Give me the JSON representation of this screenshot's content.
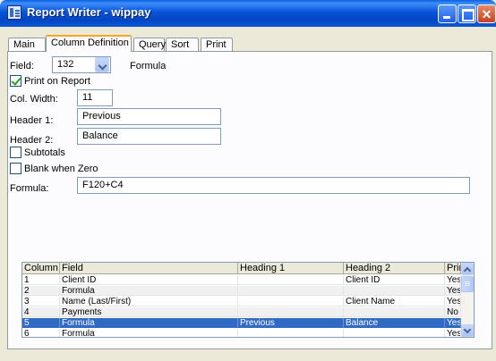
{
  "window": {
    "title": "Report Writer - wippay",
    "colors": {
      "titlebar": "#0753d8",
      "selection": "#316ac5",
      "tab_highlight": "#f5a623"
    }
  },
  "tabs": [
    {
      "label": "Main",
      "active": false
    },
    {
      "label": "Column Definition",
      "active": true
    },
    {
      "label": "Query",
      "active": false
    },
    {
      "label": "Sort",
      "active": false
    },
    {
      "label": "Print",
      "active": false
    }
  ],
  "form": {
    "field_label": "Field:",
    "field_value": "132",
    "field_type": "Formula",
    "print_on_report_label": "Print on Report",
    "print_on_report_checked": true,
    "col_width_label": "Col. Width:",
    "col_width_value": "11",
    "header1_label": "Header 1:",
    "header1_value": "Previous",
    "header2_label": "Header 2:",
    "header2_value": "Balance",
    "subtotals_label": "Subtotals",
    "subtotals_checked": false,
    "blank_when_zero_label": "Blank when Zero",
    "blank_when_zero_checked": false,
    "formula_label": "Formula:",
    "formula_value": "F120+C4"
  },
  "grid": {
    "columns": [
      "Column",
      "Field",
      "Heading 1",
      "Heading 2",
      "Print"
    ],
    "rows": [
      {
        "column": "1",
        "field": "Client ID",
        "heading1": "",
        "heading2": "Client ID",
        "print": "Yes",
        "selected": false
      },
      {
        "column": "2",
        "field": "Formula",
        "heading1": "",
        "heading2": "",
        "print": "Yes",
        "selected": false
      },
      {
        "column": "3",
        "field": "Name (Last/First)",
        "heading1": "",
        "heading2": "Client Name",
        "print": "Yes",
        "selected": false
      },
      {
        "column": "4",
        "field": "Payments",
        "heading1": "",
        "heading2": "",
        "print": "No",
        "selected": false
      },
      {
        "column": "5",
        "field": "Formula",
        "heading1": "Previous",
        "heading2": "Balance",
        "print": "Yes",
        "selected": true
      },
      {
        "column": "6",
        "field": "Formula",
        "heading1": "",
        "heading2": "",
        "print": "Yes",
        "selected": false
      }
    ]
  }
}
